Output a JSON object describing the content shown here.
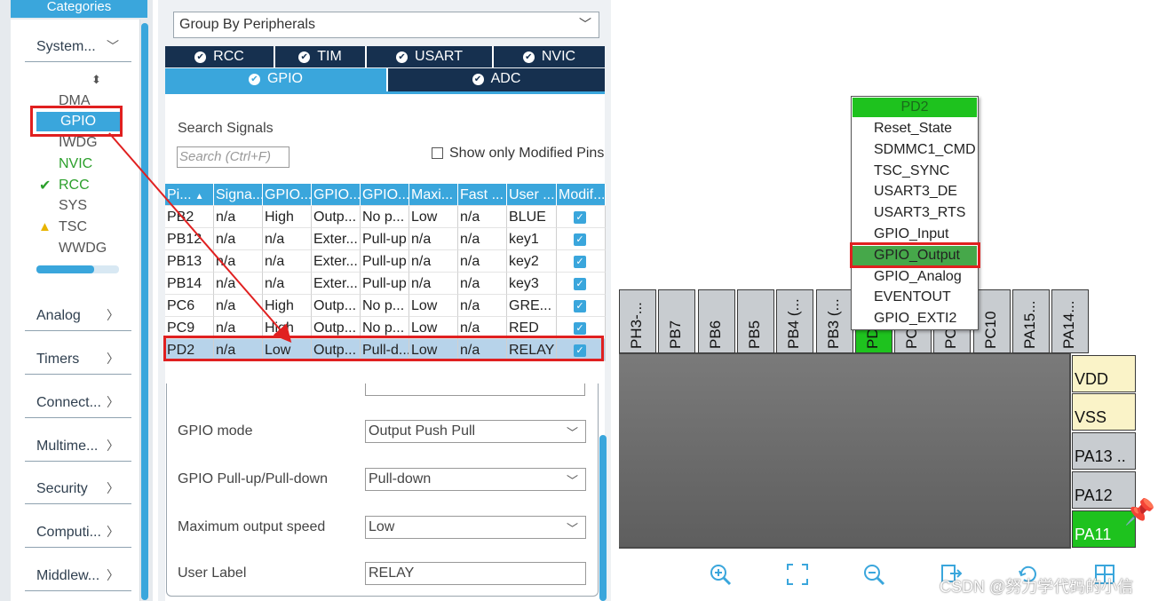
{
  "categories": {
    "header": "Categories",
    "groups": [
      {
        "label": "System...",
        "chevron": "v"
      },
      {
        "label": "Analog",
        "chevron": ">"
      },
      {
        "label": "Timers",
        "chevron": ">"
      },
      {
        "label": "Connect...",
        "chevron": ">"
      },
      {
        "label": "Multime...",
        "chevron": ">"
      },
      {
        "label": "Security",
        "chevron": ">"
      },
      {
        "label": "Computi...",
        "chevron": ">"
      },
      {
        "label": "Middlew...",
        "chevron": ">"
      }
    ],
    "system_items": [
      {
        "label": "DMA",
        "status": ""
      },
      {
        "label": "GPIO",
        "status": "selected"
      },
      {
        "label": "IWDG",
        "status": ""
      },
      {
        "label": "NVIC",
        "status": "green"
      },
      {
        "label": "RCC",
        "status": "check"
      },
      {
        "label": "SYS",
        "status": ""
      },
      {
        "label": "TSC",
        "status": "warning"
      },
      {
        "label": "WWDG",
        "status": ""
      }
    ],
    "sort_glyph": "⬍",
    "scroll_fraction": 0.7
  },
  "config": {
    "group_by": "Group By Peripherals",
    "tabs_row1": [
      "RCC",
      "TIM",
      "USART",
      "NVIC"
    ],
    "tabs_row2": [
      "GPIO",
      "ADC"
    ],
    "active_tab": "GPIO",
    "search_label": "Search Signals",
    "search_placeholder": "Search (Ctrl+F)",
    "show_modified_label": "Show only Modified Pins",
    "table": {
      "headers": [
        "Pi...",
        "Signa...",
        "GPIO...",
        "GPIO...",
        "GPIO...",
        "Maxi...",
        "Fast ...",
        "User ...",
        "Modif..."
      ],
      "sort_glyph": "▲",
      "rows": [
        [
          "PB2",
          "n/a",
          "High",
          "Outp...",
          "No p...",
          "Low",
          "n/a",
          "BLUE",
          "✓"
        ],
        [
          "PB12",
          "n/a",
          "n/a",
          "Exter...",
          "Pull-up",
          "n/a",
          "n/a",
          "key1",
          "✓"
        ],
        [
          "PB13",
          "n/a",
          "n/a",
          "Exter...",
          "Pull-up",
          "n/a",
          "n/a",
          "key2",
          "✓"
        ],
        [
          "PB14",
          "n/a",
          "n/a",
          "Exter...",
          "Pull-up",
          "n/a",
          "n/a",
          "key3",
          "✓"
        ],
        [
          "PC6",
          "n/a",
          "High",
          "Outp...",
          "No p...",
          "Low",
          "n/a",
          "GRE...",
          "✓"
        ],
        [
          "PC9",
          "n/a",
          "High",
          "Outp...",
          "No p...",
          "Low",
          "n/a",
          "RED",
          "✓"
        ],
        [
          "PD2",
          "n/a",
          "Low",
          "Outp...",
          "Pull-d...",
          "Low",
          "n/a",
          "RELAY",
          "✓"
        ]
      ],
      "selected_row": 6
    },
    "properties": [
      {
        "label": "GPIO mode",
        "value": "Output Push Pull",
        "type": "select"
      },
      {
        "label": "GPIO Pull-up/Pull-down",
        "value": "Pull-down",
        "type": "select"
      },
      {
        "label": "Maximum output speed",
        "value": "Low",
        "type": "select"
      },
      {
        "label": "User Label",
        "value": "RELAY",
        "type": "text"
      }
    ]
  },
  "chip": {
    "top_pins": [
      {
        "label": "PH3-...",
        "color": "gray"
      },
      {
        "label": "PB7",
        "color": "gray"
      },
      {
        "label": "PB6",
        "color": "gray"
      },
      {
        "label": "PB5",
        "color": "gray"
      },
      {
        "label": "PB4 (...",
        "color": "gray"
      },
      {
        "label": "PB3 (...",
        "color": "gray"
      },
      {
        "label": "PD2",
        "color": "green"
      },
      {
        "label": "PC12",
        "color": "gray"
      },
      {
        "label": "PC11",
        "color": "gray"
      },
      {
        "label": "PC10",
        "color": "gray"
      },
      {
        "label": "PA15...",
        "color": "gray"
      },
      {
        "label": "PA14...",
        "color": "gray"
      }
    ],
    "right_pins": [
      {
        "label": "VDD",
        "color": "yellow"
      },
      {
        "label": "VSS",
        "color": "yellow"
      },
      {
        "label": "PA13 ..",
        "color": "gray"
      },
      {
        "label": "PA12",
        "color": "gray"
      },
      {
        "label": "PA11",
        "color": "green"
      }
    ],
    "popup": {
      "title": "PD2",
      "items": [
        "Reset_State",
        "SDMMC1_CMD",
        "TSC_SYNC",
        "USART3_DE",
        "USART3_RTS",
        "GPIO_Input",
        "GPIO_Output",
        "GPIO_Analog",
        "EVENTOUT",
        "GPIO_EXTI2"
      ],
      "selected": "GPIO_Output"
    },
    "toolbar": [
      "zoom-in-icon",
      "fit-screen-icon",
      "zoom-out-icon",
      "export-icon",
      "rotate-icon",
      "grid-icon"
    ],
    "watermark": "CSDN @努力学代码的小信"
  },
  "colors": {
    "accent": "#3aa6dc",
    "tab_dark": "#16304f",
    "pin_green": "#1ec21e",
    "highlight_red": "#e02020"
  }
}
